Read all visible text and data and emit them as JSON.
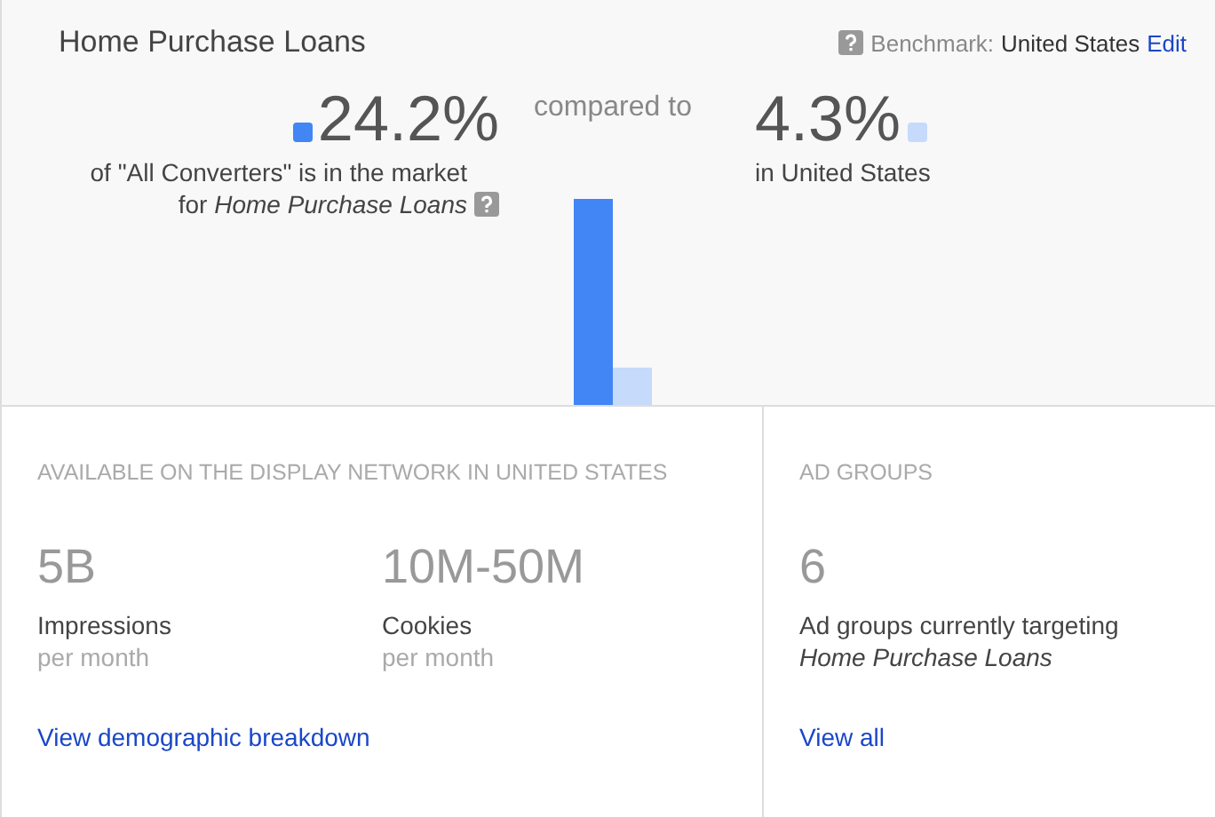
{
  "header": {
    "title": "Home Purchase Loans",
    "benchmark_label": "Benchmark:",
    "benchmark_value": "United States",
    "edit_link": "Edit"
  },
  "comparison": {
    "segment_value": "24.2%",
    "segment_line1": "of \"All Converters\" is in the market",
    "segment_line2": "for *Home Purchase Loans*",
    "compared_to": "compared to",
    "benchmark_value": "4.3%",
    "benchmark_caption": "in United States"
  },
  "availability": {
    "heading": "AVAILABLE ON THE DISPLAY NETWORK IN UNITED STATES",
    "stats": [
      {
        "value": "5B",
        "label": "Impressions",
        "sub": "per month"
      },
      {
        "value": "10M-50M",
        "label": "Cookies",
        "sub": "per month"
      }
    ],
    "link": "View demographic breakdown"
  },
  "ad_groups": {
    "heading": "AD GROUPS",
    "value": "6",
    "label_line1": "Ad groups currently targeting",
    "label_line2": "Home Purchase Loans",
    "link": "View all"
  }
}
